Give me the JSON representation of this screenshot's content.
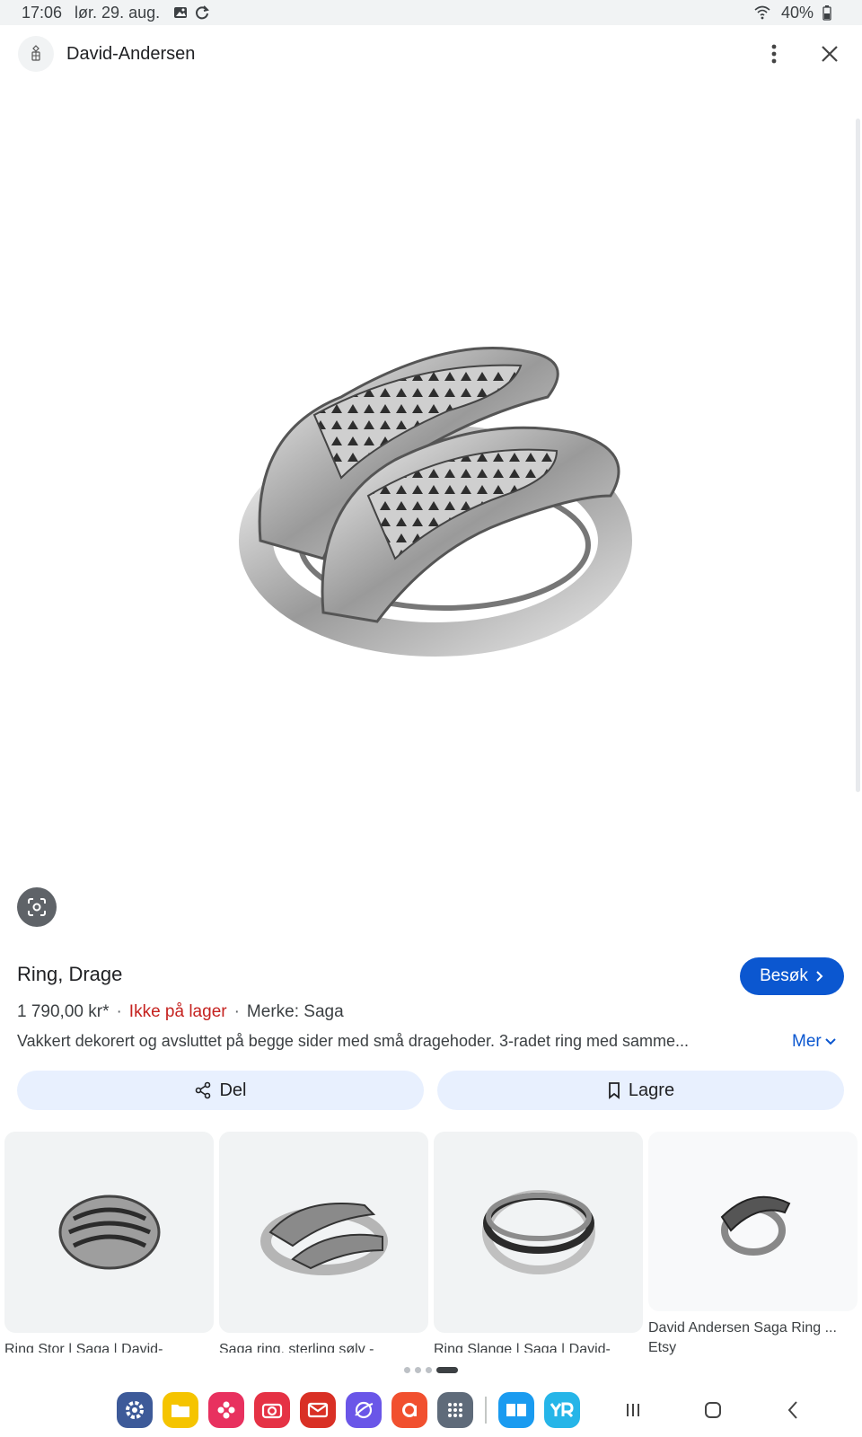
{
  "status_bar": {
    "time": "17:06",
    "date": "lør. 29. aug.",
    "battery": "40%"
  },
  "header": {
    "site_name": "David-Andersen",
    "menu_icon": "more-vert-icon",
    "close_icon": "close-icon"
  },
  "product": {
    "title": "Ring, Drage",
    "visit_label": "Besøk",
    "price": "1 790,00 kr*",
    "separator": "·",
    "stock": "Ikke på lager",
    "brand": "Merke: Saga",
    "description": "Vakkert dekorert og avsluttet på begge sider med små dragehoder. 3-radet ring med samme...",
    "more_label": "Mer"
  },
  "actions": {
    "share_label": "Del",
    "save_label": "Lagre"
  },
  "related": [
    {
      "caption": "Ring Stor | Saga | David-",
      "source": ""
    },
    {
      "caption": "Saga ring, sterling sølv -",
      "source": ""
    },
    {
      "caption": "Ring Slange | Saga | David-",
      "source": ""
    },
    {
      "caption": "David Andersen Saga Ring ...",
      "source": "Etsy"
    }
  ],
  "colors": {
    "accent": "#0b57d0",
    "stock": "#c5221f",
    "pill": "#e8f0fe"
  }
}
